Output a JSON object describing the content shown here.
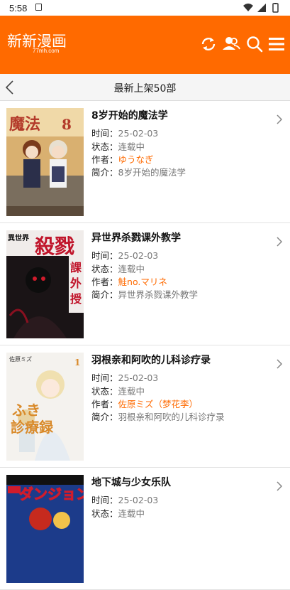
{
  "status": {
    "time": "5:58"
  },
  "header": {
    "logo_text": "新新漫画",
    "logo_sub": "77mh.com"
  },
  "subheader": {
    "title": "最新上架50部"
  },
  "labels": {
    "time": "时间：",
    "status": "状态：",
    "author": "作者：",
    "intro": "简介："
  },
  "items": [
    {
      "title": "8岁开始的魔法学",
      "time": "25-02-03",
      "status": "连载中",
      "author": "ゆうなぎ",
      "intro": "8岁开始的魔法学"
    },
    {
      "title": "异世界杀戮课外教学",
      "time": "25-02-03",
      "status": "连载中",
      "author": "鮭no.マリネ",
      "intro": "异世界杀戮课外教学"
    },
    {
      "title": "羽根亲和阿吹的儿科诊疗录",
      "time": "25-02-03",
      "status": "连载中",
      "author": "佐原ミズ（梦花李）",
      "intro": "羽根亲和阿吹的儿科诊疗录"
    },
    {
      "title": "地下城与少女乐队",
      "time": "25-02-03",
      "status": "连载中",
      "author": "",
      "intro": ""
    }
  ],
  "colors": {
    "brand": "#ff6a00",
    "author": "#ff6a00"
  }
}
